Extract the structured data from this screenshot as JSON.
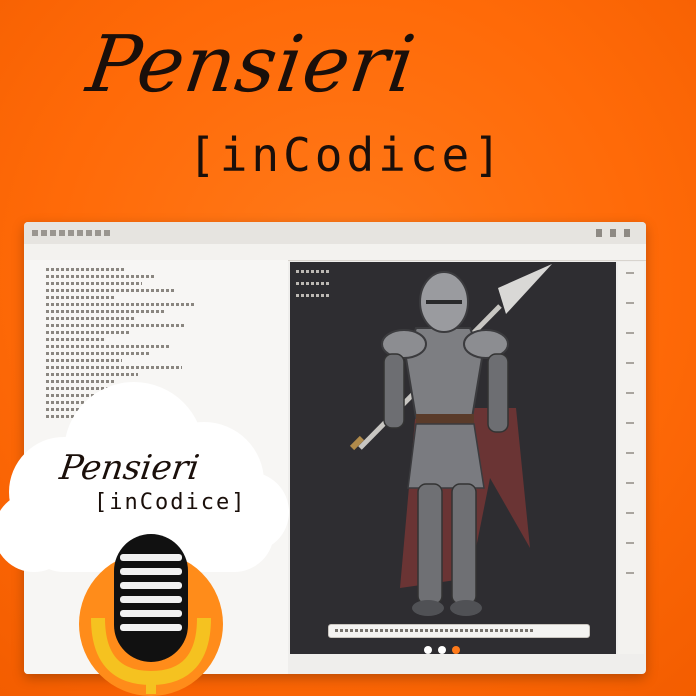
{
  "logo": {
    "title": "Pensieri",
    "subtitle": "[inCodice]"
  },
  "badge": {
    "title": "Pensieri",
    "subtitle": "[inCodice]"
  },
  "viewer": {
    "pager_count": 3,
    "active_page": 3
  },
  "icons": {
    "microphone": "microphone-icon",
    "cloud": "cloud-shape",
    "knight": "armored-knight-image"
  },
  "colors": {
    "background": "#ff6a08",
    "text": "#1a0f0a",
    "window": "#efeeec",
    "viewer": "#2e2d31"
  }
}
